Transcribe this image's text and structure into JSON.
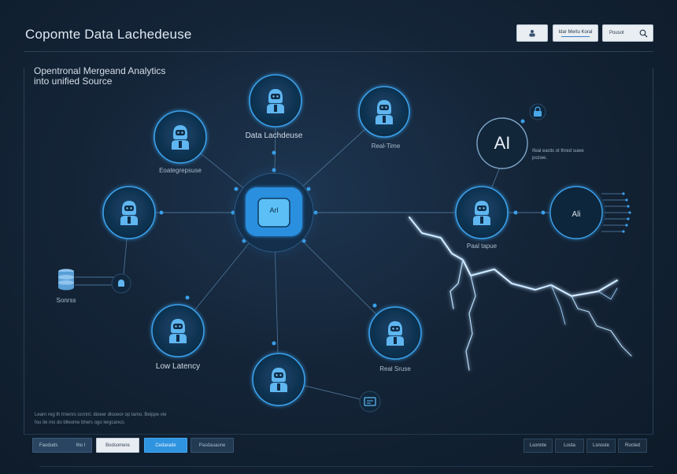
{
  "header": {
    "title": "Copomte Data Lachedeuse",
    "field_label": "Idar Mertu Koral",
    "search_label": "Pousot"
  },
  "main": {
    "subtitle_line1": "Opentronal Mergeand Analytics",
    "subtitle_line2": "into unified Source",
    "hub_label": "Arl",
    "ai_big_label": "AI",
    "ai_small_label": "Ali",
    "ai_note": "Ifeal eards ot thred suwe pozwe.",
    "description": "Learn reg th trnenrs ocrnnt. dioeer dlooeor op tamo. Beippe vie fou ite mo do blleome bhers ogo lergcanco.",
    "nodes": {
      "top": "Data Lachdeuse",
      "top_right": "Real-Time",
      "upper_left": "Eoategrepsuse",
      "lower_left": "Low Latency",
      "lower_right": "Real Sruse",
      "right": "Paal tapue",
      "sources": "Sonrss"
    }
  },
  "footer": {
    "left_buttons": {
      "b1_label": "Faoduds",
      "b1_extra": "Iho l",
      "b2_label": "Bodsomere",
      "b3_label": "Cedarade",
      "b4_label": "Pasdauaune"
    },
    "right_buttons": [
      "Lsonnte",
      "Losta",
      "Lsnoste",
      "Rocted"
    ]
  }
}
